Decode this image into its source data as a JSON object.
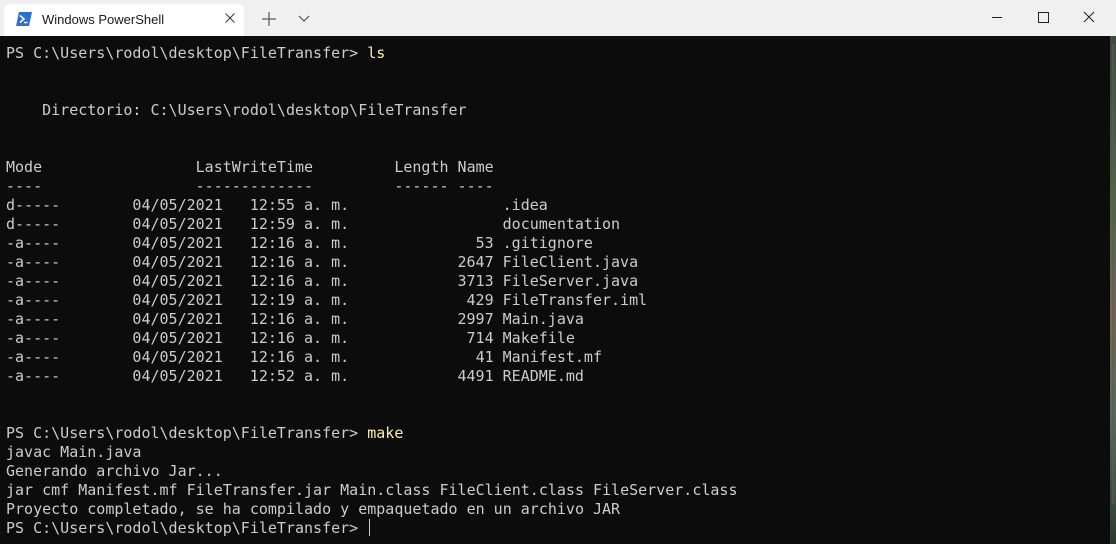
{
  "window": {
    "tab_title": "Windows PowerShell",
    "icons": {
      "tab_icon": "powershell-icon",
      "tab_close": "close-icon",
      "new_tab": "plus-icon",
      "dropdown": "chevron-down-icon",
      "minimize": "minimize-icon",
      "maximize": "maximize-icon",
      "close": "close-icon"
    }
  },
  "terminal": {
    "ls_prompt": "PS C:\\Users\\rodol\\desktop\\FileTransfer> ",
    "ls_command": "ls",
    "directory": "    Directorio: C:\\Users\\rodol\\desktop\\FileTransfer",
    "header": "Mode                 LastWriteTime         Length Name",
    "separator": "----                 -------------         ------ ----",
    "rows": [
      {
        "mode": "d-----",
        "date": "04/05/2021",
        "time": "12:55 a. m.",
        "length": "",
        "name": ".idea"
      },
      {
        "mode": "d-----",
        "date": "04/05/2021",
        "time": "12:59 a. m.",
        "length": "",
        "name": "documentation"
      },
      {
        "mode": "-a----",
        "date": "04/05/2021",
        "time": "12:16 a. m.",
        "length": "53",
        "name": ".gitignore"
      },
      {
        "mode": "-a----",
        "date": "04/05/2021",
        "time": "12:16 a. m.",
        "length": "2647",
        "name": "FileClient.java"
      },
      {
        "mode": "-a----",
        "date": "04/05/2021",
        "time": "12:16 a. m.",
        "length": "3713",
        "name": "FileServer.java"
      },
      {
        "mode": "-a----",
        "date": "04/05/2021",
        "time": "12:19 a. m.",
        "length": "429",
        "name": "FileTransfer.iml"
      },
      {
        "mode": "-a----",
        "date": "04/05/2021",
        "time": "12:16 a. m.",
        "length": "2997",
        "name": "Main.java"
      },
      {
        "mode": "-a----",
        "date": "04/05/2021",
        "time": "12:16 a. m.",
        "length": "714",
        "name": "Makefile"
      },
      {
        "mode": "-a----",
        "date": "04/05/2021",
        "time": "12:16 a. m.",
        "length": "41",
        "name": "Manifest.mf"
      },
      {
        "mode": "-a----",
        "date": "04/05/2021",
        "time": "12:52 a. m.",
        "length": "4491",
        "name": "README.md"
      }
    ],
    "make_prompt": "PS C:\\Users\\rodol\\desktop\\FileTransfer> ",
    "make_command": "make",
    "make_output": [
      "javac Main.java",
      "Generando archivo Jar...",
      "jar cmf Manifest.mf FileTransfer.jar Main.class FileClient.class FileServer.class",
      "Proyecto completado, se ha compilado y empaquetado en un archivo JAR"
    ],
    "final_prompt": "PS C:\\Users\\rodol\\desktop\\FileTransfer> "
  },
  "colors": {
    "background": "#0c0c0c",
    "text": "#cccccc",
    "command": "#f9f1a5",
    "titlebar": "#f0f0f0"
  }
}
